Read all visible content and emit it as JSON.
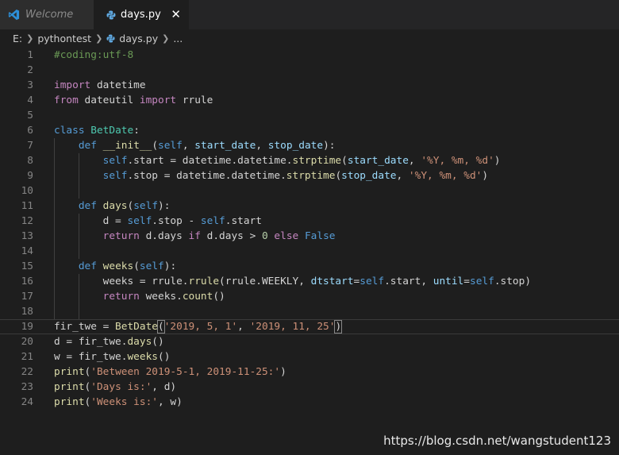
{
  "tabs": [
    {
      "label": "Welcome",
      "icon": "vscode-icon",
      "active": false
    },
    {
      "label": "days.py",
      "icon": "python-icon",
      "active": true
    }
  ],
  "close_glyph": "✕",
  "breadcrumb": {
    "drive": "E:",
    "folder": "pythontest",
    "file": "days.py",
    "more": "..."
  },
  "colors": {
    "keyword": "#569cd6",
    "control": "#c586c0",
    "function": "#dcdcaa",
    "class": "#4ec9b0",
    "string": "#ce9178",
    "number": "#b5cea8",
    "comment": "#6a9955",
    "param": "#9cdcfe"
  },
  "code_lines": [
    {
      "n": "1",
      "text": "#coding:utf-8"
    },
    {
      "n": "2",
      "text": ""
    },
    {
      "n": "3",
      "text": "import datetime"
    },
    {
      "n": "4",
      "text": "from dateutil import rrule"
    },
    {
      "n": "5",
      "text": ""
    },
    {
      "n": "6",
      "text": "class BetDate:"
    },
    {
      "n": "7",
      "text": "    def __init__(self, start_date, stop_date):"
    },
    {
      "n": "8",
      "text": "        self.start = datetime.datetime.strptime(start_date, '%Y, %m, %d')"
    },
    {
      "n": "9",
      "text": "        self.stop = datetime.datetime.strptime(stop_date, '%Y, %m, %d')"
    },
    {
      "n": "10",
      "text": ""
    },
    {
      "n": "11",
      "text": "    def days(self):"
    },
    {
      "n": "12",
      "text": "        d = self.stop - self.start"
    },
    {
      "n": "13",
      "text": "        return d.days if d.days > 0 else False"
    },
    {
      "n": "14",
      "text": ""
    },
    {
      "n": "15",
      "text": "    def weeks(self):"
    },
    {
      "n": "16",
      "text": "        weeks = rrule.rrule(rrule.WEEKLY, dtstart=self.start, until=self.stop)"
    },
    {
      "n": "17",
      "text": "        return weeks.count()"
    },
    {
      "n": "18",
      "text": ""
    },
    {
      "n": "19",
      "text": "fir_twe = BetDate('2019, 5, 1', '2019, 11, 25')"
    },
    {
      "n": "20",
      "text": "d = fir_twe.days()"
    },
    {
      "n": "21",
      "text": "w = fir_twe.weeks()"
    },
    {
      "n": "22",
      "text": "print('Between 2019-5-1, 2019-11-25:')"
    },
    {
      "n": "23",
      "text": "print('Days is:', d)"
    },
    {
      "n": "24",
      "text": "print('Weeks is:', w)"
    }
  ],
  "current_line": "19",
  "watermark": "https://blog.csdn.net/wangstudent123"
}
